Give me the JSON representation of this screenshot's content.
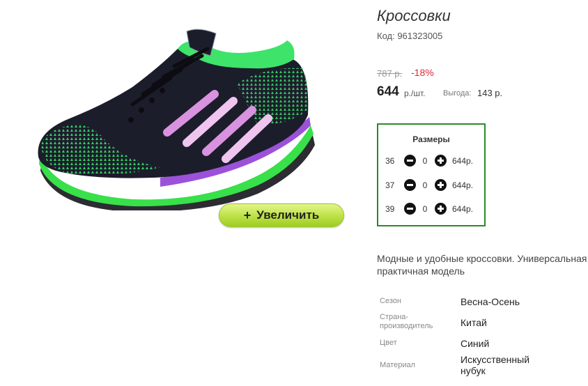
{
  "product": {
    "title": "Кроссовки",
    "code": "Код: 961323005",
    "old_price": "787 р.",
    "discount": "-18%",
    "price": "644",
    "unit": "р./шт.",
    "benefit_label": "Выгода:",
    "benefit_value": "143 р.",
    "image_alt_icon": "sneaker-image"
  },
  "zoom": {
    "plus": "+",
    "label": "Увеличить"
  },
  "sizes": {
    "title": "Размеры",
    "rows": [
      {
        "size": "36",
        "qty": "0",
        "price": "644р."
      },
      {
        "size": "37",
        "qty": "0",
        "price": "644р."
      },
      {
        "size": "39",
        "qty": "0",
        "price": "644р."
      }
    ],
    "border_color": "#2a8a2a"
  },
  "description": {
    "line1": "Модные и удобные кроссовки. Универсальная",
    "line2": "практичная модель"
  },
  "specs": [
    {
      "label": "Сезон",
      "value": "Весна-Осень"
    },
    {
      "label": "Страна-\nпроизводитель",
      "value": "Китай"
    },
    {
      "label": "Цвет",
      "value": "Синий"
    },
    {
      "label": "Материал",
      "value": "Искусственный\nнубук"
    }
  ],
  "colors": {
    "discount": "#e0263a",
    "accent_green": "#bfe34a"
  }
}
